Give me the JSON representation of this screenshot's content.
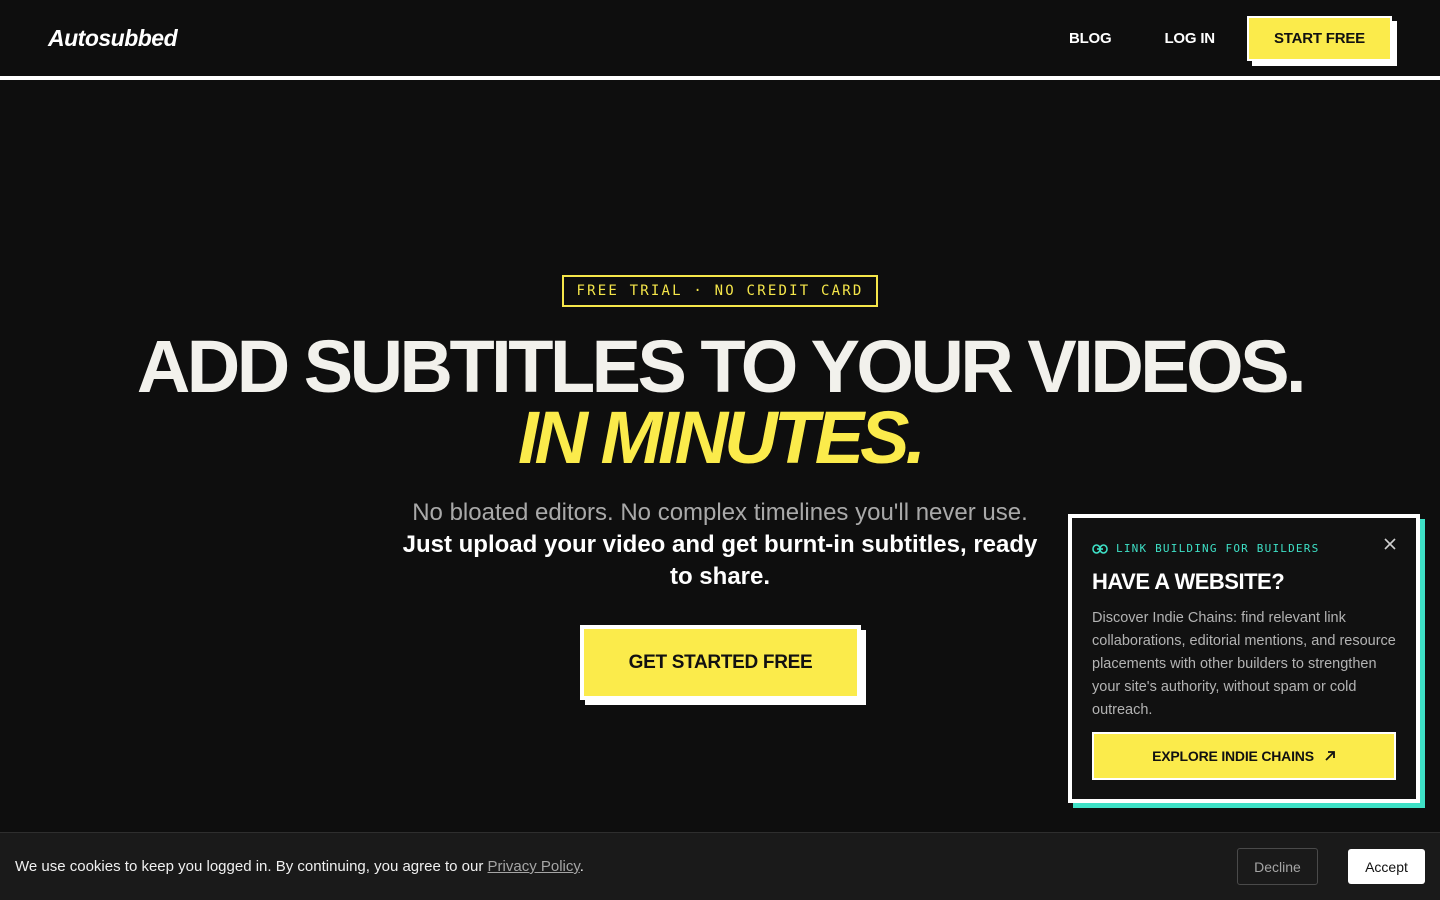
{
  "header": {
    "logo": "Autosubbed",
    "nav": {
      "blog": "BLOG",
      "login": "LOG IN",
      "start": "START FREE"
    }
  },
  "hero": {
    "badge": "FREE TRIAL · NO CREDIT CARD",
    "headline": "ADD SUBTITLES TO YOUR VIDEOS.",
    "headline_accent": "IN MINUTES.",
    "subline": "No bloated editors. No complex timelines you'll never use.",
    "subline_bold": "Just upload your video and get burnt-in subtitles, ready to share.",
    "cta": "GET STARTED FREE"
  },
  "popup": {
    "tag": "LINK BUILDING FOR BUILDERS",
    "title": "HAVE A WEBSITE?",
    "body": "Discover Indie Chains: find relevant link collaborations, editorial mentions, and resource placements with other builders to strengthen your site's authority, without spam or cold outreach.",
    "button": "EXPLORE INDIE CHAINS",
    "icons": {
      "tag": "link-icon",
      "close": "close-icon",
      "button": "arrow-up-right-icon"
    }
  },
  "cookie": {
    "text": "We use cookies to keep you logged in. By continuing, you agree to our ",
    "link": "Privacy Policy",
    "period": ".",
    "decline": "Decline",
    "accept": "Accept"
  },
  "colors": {
    "background": "#0e0e0e",
    "accent_yellow": "#fbeb4b",
    "accent_teal": "#3ee0c6",
    "white": "#ffffff"
  }
}
